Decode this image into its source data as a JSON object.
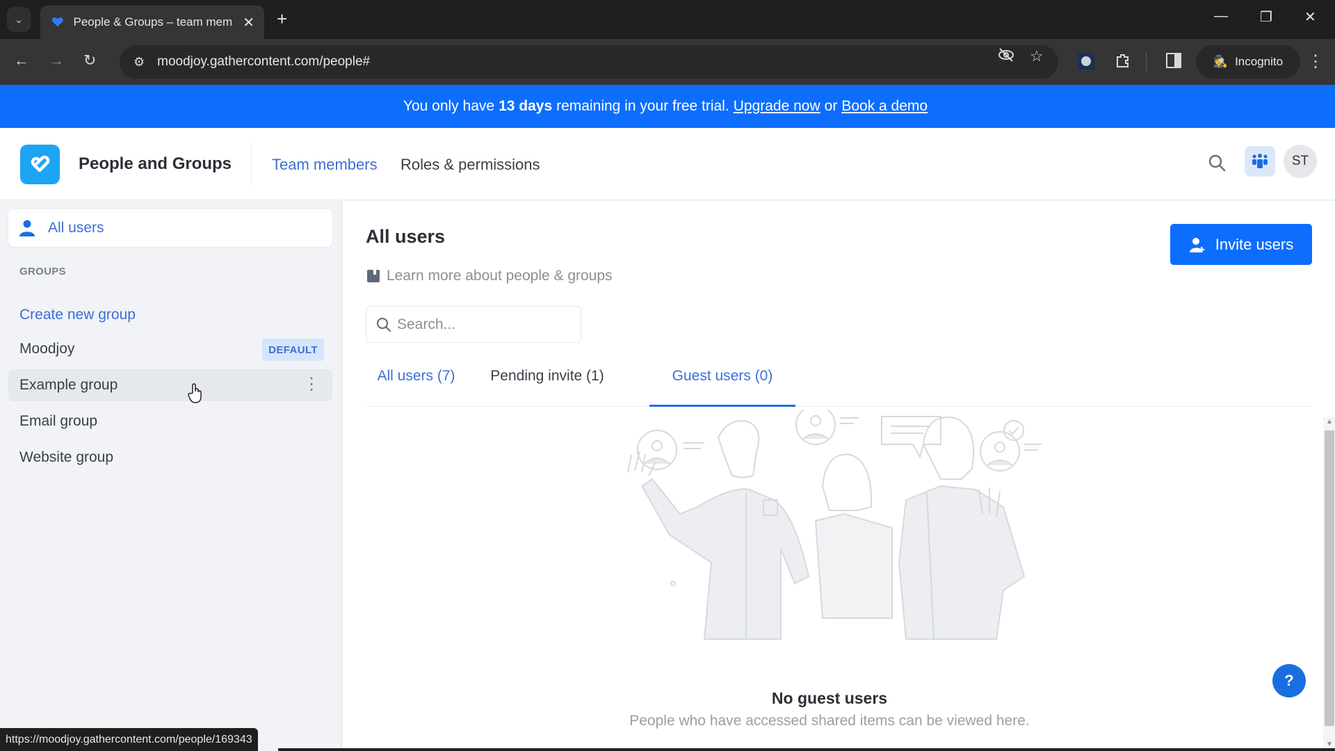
{
  "browser": {
    "tab_title": "People & Groups – team memb",
    "url": "moodjoy.gathercontent.com/people#",
    "incognito_label": "Incognito",
    "status_url": "https://moodjoy.gathercontent.com/people/169343"
  },
  "banner": {
    "prefix": "You only have",
    "days": "13 days",
    "suffix": "remaining in your free trial.",
    "upgrade_link": "Upgrade now",
    "or": "or",
    "demo_link": "Book a demo",
    "color": "#0d6efd"
  },
  "header": {
    "title": "People and Groups",
    "nav": [
      {
        "label": "Team members",
        "active": true
      },
      {
        "label": "Roles & permissions",
        "active": false
      }
    ],
    "avatar_initials": "ST"
  },
  "sidebar": {
    "all_users_label": "All users",
    "groups_heading": "GROUPS",
    "create_group_label": "Create new group",
    "groups": [
      {
        "name": "Moodjoy",
        "badge": "DEFAULT"
      },
      {
        "name": "Example group"
      },
      {
        "name": "Email group"
      },
      {
        "name": "Website group"
      }
    ]
  },
  "main": {
    "title": "All users",
    "invite_button": "Invite users",
    "learn_more": "Learn more about people & groups",
    "search_placeholder": "Search...",
    "tabs": [
      {
        "label": "All users (7)"
      },
      {
        "label": "Pending invite (1)"
      },
      {
        "label": "Guest users (0)",
        "active": true
      }
    ],
    "empty_title": "No guest users",
    "empty_description": "People who have accessed shared items can be viewed here.",
    "help_label": "?"
  }
}
